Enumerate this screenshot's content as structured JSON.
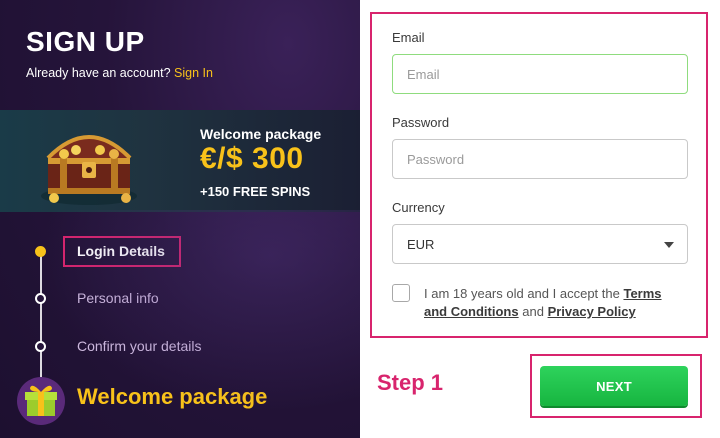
{
  "header": {
    "title": "SIGN UP",
    "have_account": "Already have an account?",
    "signin_link": "Sign In"
  },
  "promo": {
    "label": "Welcome package",
    "amount": "€/$ 300",
    "spins": "+150 FREE SPINS",
    "image_icon": "treasure-chest-icon"
  },
  "steps": [
    {
      "label": "Login Details",
      "active": true
    },
    {
      "label": "Personal info",
      "active": false
    },
    {
      "label": "Confirm your details",
      "active": false
    }
  ],
  "welcome_footer": {
    "title": "Welcome package",
    "icon": "gift-icon"
  },
  "form": {
    "email_label": "Email",
    "email_placeholder": "Email",
    "password_label": "Password",
    "password_placeholder": "Password",
    "currency_label": "Currency",
    "currency_value": "EUR",
    "terms_prefix": "I am 18 years old and I accept the",
    "terms_link": "Terms and Conditions",
    "terms_and": "and",
    "privacy_link": "Privacy Policy"
  },
  "annotation": {
    "step_text": "Step 1"
  },
  "actions": {
    "next_label": "NEXT"
  },
  "colors": {
    "accent_yellow": "#f8c21a",
    "highlight_pink": "#d8246d",
    "next_green": "#1fbf48",
    "panel_purple": "#25143a"
  }
}
